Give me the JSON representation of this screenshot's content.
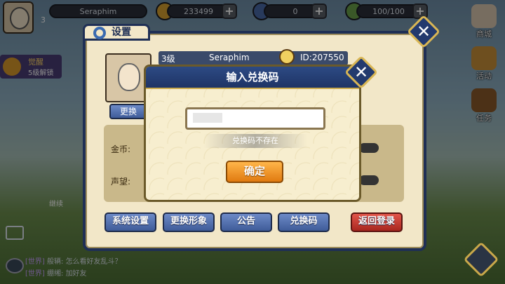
{
  "hud": {
    "player_name": "Seraphim",
    "player_level": "3",
    "gold": "233499",
    "tickets": "0",
    "stamina": "100/100"
  },
  "side_menu": [
    "商城",
    "活动",
    "任务"
  ],
  "left_badge": {
    "title": "觉醒",
    "subtitle": "5级解锁"
  },
  "settings": {
    "title": "设置",
    "level": "3级",
    "name": "Seraphim",
    "id": "ID:207550",
    "change_btn": "更换",
    "labels": [
      "金币:",
      "声望:"
    ],
    "buttons": [
      "系统设置",
      "更换形象",
      "公告",
      "兑换码",
      "返回登录"
    ]
  },
  "dialog": {
    "title": "输入兑换码",
    "error": "兑换码不存在",
    "confirm": "确定"
  },
  "bg_tag": "继续",
  "chat": [
    {
      "channel": "[世界]",
      "name": "般辆:",
      "text": "怎么看好友乱斗？"
    },
    {
      "channel": "[世界]",
      "name": "绷缃:",
      "text": "加好友"
    }
  ]
}
